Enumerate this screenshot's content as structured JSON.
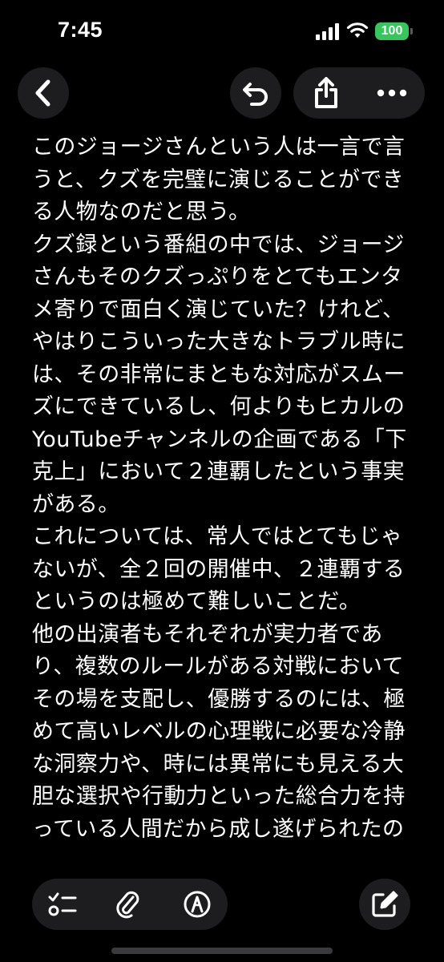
{
  "status_bar": {
    "time": "7:45",
    "battery_level": "100",
    "battery_color": "#34c759",
    "icons": [
      "cellular-signal-icon",
      "wifi-icon",
      "battery-icon"
    ]
  },
  "toolbar": {
    "icons": [
      "chevron-left-icon",
      "undo-icon",
      "share-icon",
      "ellipsis-icon"
    ]
  },
  "note": {
    "lines": [
      "このジョージさんという人は一言で言",
      "うと、クズを完璧に演じることができ",
      "る人物なのだと思う。",
      "クズ録という番組の中では、ジョージ",
      "さんもそのクズっぷりをとてもエンタ",
      "メ寄りで面白く演じていた？けれど、",
      "やはりこういった大きなトラブル時に",
      "は、その非常にまともな対応がスムー",
      "ズにできているし、何よりもヒカルの",
      "YouTubeチャンネルの企画である「下",
      "克上」において２連覇したという事実",
      "がある。",
      "これについては、常人ではとてもじゃ",
      "ないが、全２回の開催中、２連覇する",
      "というのは極めて難しいことだ。",
      "他の出演者もそれぞれが実力者であ",
      "り、複数のルールがある対戦において",
      "その場を支配し、優勝するのには、極",
      "めて高いレベルの心理戦に必要な冷静",
      "な洞察力や、時には異常にも見える大",
      "胆な選択や行動力といった総合力を持",
      "っている人間だから成し遂げられたの"
    ]
  },
  "bottom_toolbar": {
    "icons": [
      "checklist-icon",
      "paperclip-icon",
      "markup-pen-icon",
      "compose-icon"
    ]
  }
}
